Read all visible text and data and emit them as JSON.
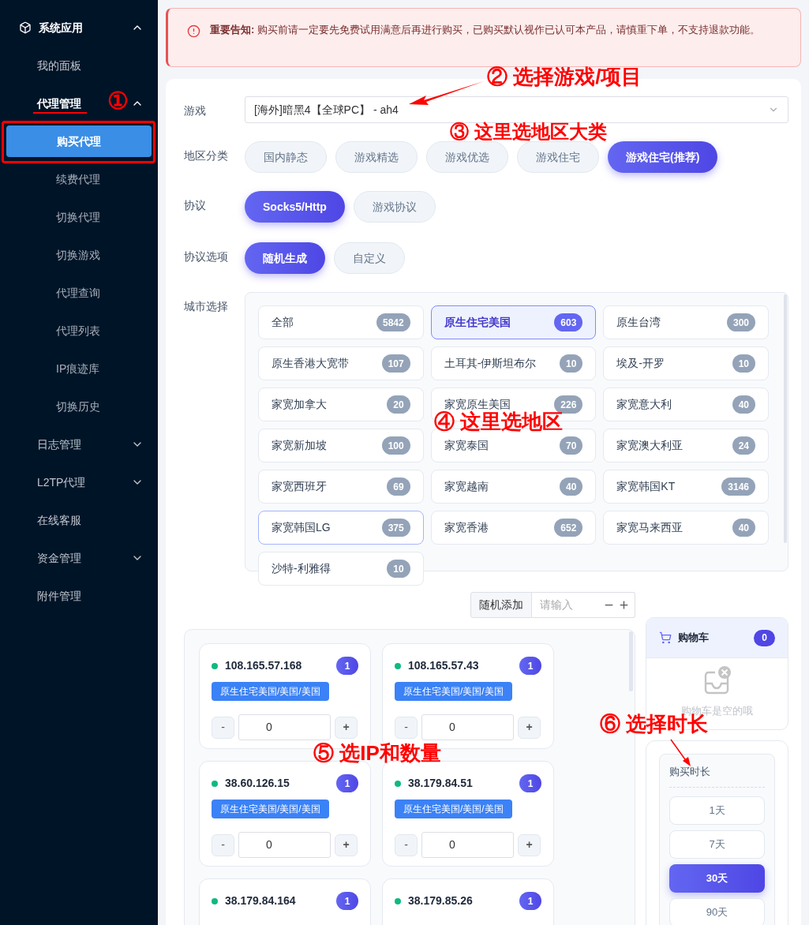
{
  "sidebar": {
    "title": "系统应用",
    "expanded": true,
    "items": [
      {
        "label": "我的面板",
        "selected": false
      },
      {
        "label": "代理管理",
        "selected": false,
        "expanded": true,
        "children": [
          {
            "label": "购买代理",
            "selected": true
          },
          {
            "label": "续费代理",
            "selected": false
          },
          {
            "label": "切换代理",
            "selected": false
          },
          {
            "label": "切换游戏",
            "selected": false
          },
          {
            "label": "代理查询",
            "selected": false
          },
          {
            "label": "代理列表",
            "selected": false
          },
          {
            "label": "IP痕迹库",
            "selected": false
          },
          {
            "label": "切换历史",
            "selected": false
          }
        ]
      },
      {
        "label": "日志管理",
        "selected": false,
        "expanded": false
      },
      {
        "label": "L2TP代理",
        "selected": false,
        "expanded": false
      },
      {
        "label": "在线客服",
        "selected": false
      },
      {
        "label": "资金管理",
        "selected": false,
        "expanded": false
      },
      {
        "label": "附件管理",
        "selected": false
      }
    ]
  },
  "notice": "**重要告知:** 购买前请一定要先免费试用满意后再进行购买，已购买默认视作已认可本产品，请慎重下单，不支持退款功能。",
  "form": {
    "game": {
      "label": "游戏",
      "value": "[海外]暗黑4【全球PC】 - ah4"
    },
    "region_category": {
      "label": "地区分类",
      "options": [
        {
          "label": "国内静态",
          "selected": false
        },
        {
          "label": "游戏精选",
          "selected": false
        },
        {
          "label": "游戏优选",
          "selected": false
        },
        {
          "label": "游戏住宅",
          "selected": false
        },
        {
          "label": "游戏住宅(推荐)",
          "selected": true
        }
      ]
    },
    "protocol": {
      "label": "协议",
      "options": [
        {
          "label": "Socks5/Http",
          "selected": true
        },
        {
          "label": "游戏协议",
          "selected": false
        }
      ]
    },
    "protocol_option": {
      "label": "协议选项",
      "options": [
        {
          "label": "随机生成",
          "selected": true
        },
        {
          "label": "自定义",
          "selected": false
        }
      ]
    },
    "city": {
      "label": "城市选择",
      "options": [
        {
          "name": "全部",
          "count": "5842",
          "selected": false,
          "hovered": false
        },
        {
          "name": "原生住宅美国",
          "count": "603",
          "selected": true,
          "hovered": false
        },
        {
          "name": "原生台湾",
          "count": "300",
          "selected": false,
          "hovered": false
        },
        {
          "name": "原生香港大宽带",
          "count": "107",
          "selected": false,
          "hovered": false
        },
        {
          "name": "土耳其-伊斯坦布尔",
          "count": "10",
          "selected": false,
          "hovered": false
        },
        {
          "name": "埃及-开罗",
          "count": "10",
          "selected": false,
          "hovered": false
        },
        {
          "name": "家宽加拿大",
          "count": "20",
          "selected": false,
          "hovered": false
        },
        {
          "name": "家宽原生美国",
          "count": "226",
          "selected": false,
          "hovered": false
        },
        {
          "name": "家宽意大利",
          "count": "40",
          "selected": false,
          "hovered": false
        },
        {
          "name": "家宽新加坡",
          "count": "100",
          "selected": false,
          "hovered": false
        },
        {
          "name": "家宽泰国",
          "count": "70",
          "selected": false,
          "hovered": false
        },
        {
          "name": "家宽澳大利亚",
          "count": "24",
          "selected": false,
          "hovered": false
        },
        {
          "name": "家宽西班牙",
          "count": "69",
          "selected": false,
          "hovered": false
        },
        {
          "name": "家宽越南",
          "count": "40",
          "selected": false,
          "hovered": false
        },
        {
          "name": "家宽韩国KT",
          "count": "3146",
          "selected": false,
          "hovered": false
        },
        {
          "name": "家宽韩国LG",
          "count": "375",
          "selected": false,
          "hovered": true
        },
        {
          "name": "家宽香港",
          "count": "652",
          "selected": false,
          "hovered": false
        },
        {
          "name": "家宽马来西亚",
          "count": "40",
          "selected": false,
          "hovered": false
        },
        {
          "name": "沙特-利雅得",
          "count": "10",
          "selected": false,
          "hovered": false
        }
      ]
    }
  },
  "random_add": {
    "label": "随机添加",
    "placeholder": "请输入"
  },
  "ips": [
    {
      "ip": "108.165.57.168",
      "count": "1",
      "tag": "原生住宅美国/美国/美国",
      "quantity": "0",
      "minus": "-",
      "plus": "+"
    },
    {
      "ip": "108.165.57.43",
      "count": "1",
      "tag": "原生住宅美国/美国/美国",
      "quantity": "0",
      "minus": "-",
      "plus": "+"
    },
    {
      "ip": "38.60.126.15",
      "count": "1",
      "tag": "原生住宅美国/美国/美国",
      "quantity": "0",
      "minus": "-",
      "plus": "+"
    },
    {
      "ip": "38.179.84.51",
      "count": "1",
      "tag": "原生住宅美国/美国/美国",
      "quantity": "0",
      "minus": "-",
      "plus": "+"
    },
    {
      "ip": "38.179.84.164",
      "count": "1"
    },
    {
      "ip": "38.179.85.26",
      "count": "1"
    }
  ],
  "cart": {
    "title": "购物车",
    "count": "0",
    "empty_text": "购物车是空的哦"
  },
  "duration": {
    "title": "购买时长",
    "options": [
      {
        "label": "1天",
        "selected": false
      },
      {
        "label": "7天",
        "selected": false
      },
      {
        "label": "30天",
        "selected": true
      },
      {
        "label": "90天",
        "selected": false
      }
    ]
  },
  "annotations": [
    "①",
    "② 选择游戏/项目",
    "③ 这里选地区大类",
    "④ 这里选地区",
    "⑤ 选IP和数量",
    "⑥ 选择时长"
  ]
}
